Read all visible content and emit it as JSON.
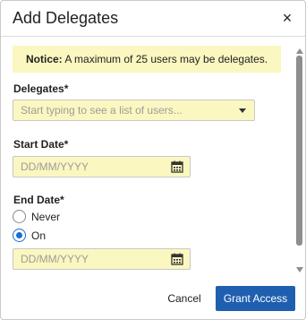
{
  "dialog": {
    "title": "Add Delegates",
    "close_glyph": "×"
  },
  "notice": {
    "label": "Notice:",
    "text": " A maximum of 25 users may be delegates."
  },
  "delegates": {
    "label": "Delegates*",
    "placeholder": "Start typing to see a list of users...",
    "icon": "chevron-down-icon"
  },
  "start_date": {
    "label": "Start Date*",
    "placeholder": "DD/MM/YYYY",
    "icon": "calendar-icon"
  },
  "end_date": {
    "label": "End Date*",
    "options": [
      {
        "label": "Never",
        "checked": false
      },
      {
        "label": "On",
        "checked": true
      }
    ],
    "placeholder": "DD/MM/YYYY",
    "icon": "calendar-icon"
  },
  "footer": {
    "cancel_label": "Cancel",
    "grant_label": "Grant Access"
  },
  "colors": {
    "primary": "#1f5fb0",
    "field_bg": "#fbf7c0",
    "radio_accent": "#1a6dd1"
  }
}
